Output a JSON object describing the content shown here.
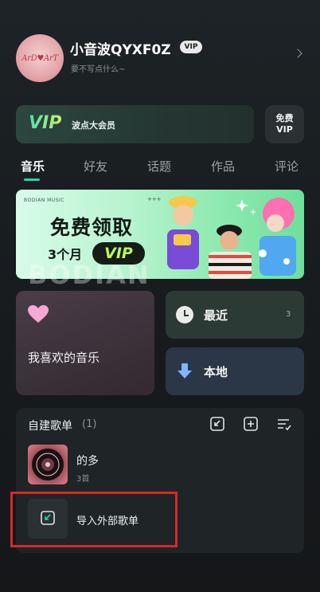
{
  "profile": {
    "avatar_text": "ArD♥ArT",
    "username": "小音波QYXF0Z",
    "vip_badge": "VIP",
    "signature": "要不写点什么~"
  },
  "vip_card": {
    "logo": "VIP",
    "title": "波点大会员",
    "free_line1": "免费",
    "free_line2": "VIP"
  },
  "tabs": [
    {
      "label": "音乐",
      "active": true
    },
    {
      "label": "好友",
      "active": false
    },
    {
      "label": "话题",
      "active": false
    },
    {
      "label": "作品",
      "active": false
    },
    {
      "label": "评论",
      "active": false
    }
  ],
  "banner": {
    "brand": "BODIAN MUSIC",
    "plus": "+++",
    "title": "免费领取",
    "month": "3个月",
    "vip": "VIP",
    "watermark": "BODIAN"
  },
  "cards": {
    "favorite_label": "我喜欢的音乐",
    "recent_label": "最近",
    "recent_count": "3",
    "local_label": "本地"
  },
  "playlists": {
    "title": "自建歌单",
    "count": "(1)",
    "items": [
      {
        "name": "的多",
        "sub": "3首"
      }
    ],
    "import_label": "导入外部歌单"
  },
  "colors": {
    "accent": "#25d6a6",
    "highlight": "#d42a2a"
  }
}
